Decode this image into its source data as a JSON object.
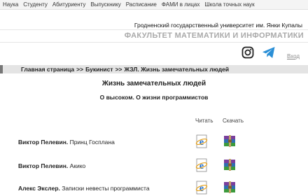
{
  "topnav": {
    "items": [
      "Наука",
      "Студенту",
      "Абитуриенту",
      "Выпускнику",
      "Расписание",
      "ФАМИ в лицах",
      "Школа точных наук"
    ]
  },
  "header": {
    "university": "Гродненский государственный университет им. Янки Купалы",
    "faculty": "ФАКУЛЬТЕТ МАТЕМАТИКИ И ИНФОРМАТИКИ",
    "login": "Вход"
  },
  "breadcrumb": {
    "items": [
      "Главная страница",
      "Букинист",
      "ЖЗЛ. Жизнь замечательных людей"
    ],
    "separator": ">>"
  },
  "main": {
    "title": "Жизнь замечательных людей",
    "subtitle": "О высоком. О жизни программистов",
    "col_read": "Читать",
    "col_download": "Скачать",
    "books": [
      {
        "author": "Виктор Пелевин.",
        "title": "Принц Госплана"
      },
      {
        "author": "Виктор Пелевин.",
        "title": "Акико"
      },
      {
        "author": "Алекс Экслер.",
        "title": "Записки невесты программиста"
      }
    ]
  },
  "icons": {
    "instagram": "instagram-icon",
    "telegram": "telegram-icon",
    "read": "internet-explorer-icon",
    "download": "winrar-archive-icon"
  },
  "colors": {
    "telegram": "#2a8fd6",
    "faculty_text": "#a9a9a9",
    "breadcrumb_bg": "#e4e4e4"
  }
}
